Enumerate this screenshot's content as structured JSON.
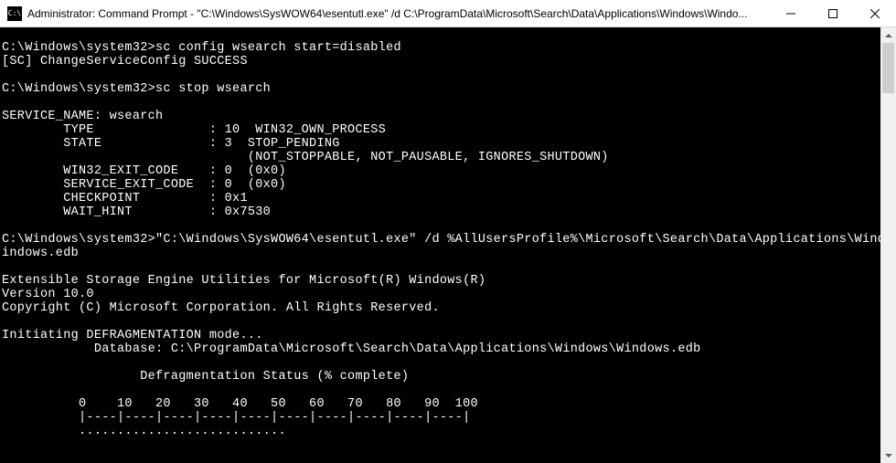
{
  "titlebar": {
    "icon_glyph": "C:\\",
    "title": "Administrator: Command Prompt - \"C:\\Windows\\SysWOW64\\esentutl.exe\"  /d C:\\ProgramData\\Microsoft\\Search\\Data\\Applications\\Windows\\Windo..."
  },
  "terminal": {
    "lines": [
      "",
      "C:\\Windows\\system32>sc config wsearch start=disabled",
      "[SC] ChangeServiceConfig SUCCESS",
      "",
      "C:\\Windows\\system32>sc stop wsearch",
      "",
      "SERVICE_NAME: wsearch",
      "        TYPE               : 10  WIN32_OWN_PROCESS",
      "        STATE              : 3  STOP_PENDING",
      "                                (NOT_STOPPABLE, NOT_PAUSABLE, IGNORES_SHUTDOWN)",
      "        WIN32_EXIT_CODE    : 0  (0x0)",
      "        SERVICE_EXIT_CODE  : 0  (0x0)",
      "        CHECKPOINT         : 0x1",
      "        WAIT_HINT          : 0x7530",
      "",
      "C:\\Windows\\system32>\"C:\\Windows\\SysWOW64\\esentutl.exe\" /d %AllUsersProfile%\\Microsoft\\Search\\Data\\Applications\\Windows\\W",
      "indows.edb",
      "",
      "Extensible Storage Engine Utilities for Microsoft(R) Windows(R)",
      "Version 10.0",
      "Copyright (C) Microsoft Corporation. All Rights Reserved.",
      "",
      "Initiating DEFRAGMENTATION mode...",
      "            Database: C:\\ProgramData\\Microsoft\\Search\\Data\\Applications\\Windows\\Windows.edb",
      "",
      "                  Defragmentation Status (% complete)",
      "",
      "          0    10   20   30   40   50   60   70   80   90  100",
      "          |----|----|----|----|----|----|----|----|----|----|",
      "          ..........................."
    ]
  }
}
